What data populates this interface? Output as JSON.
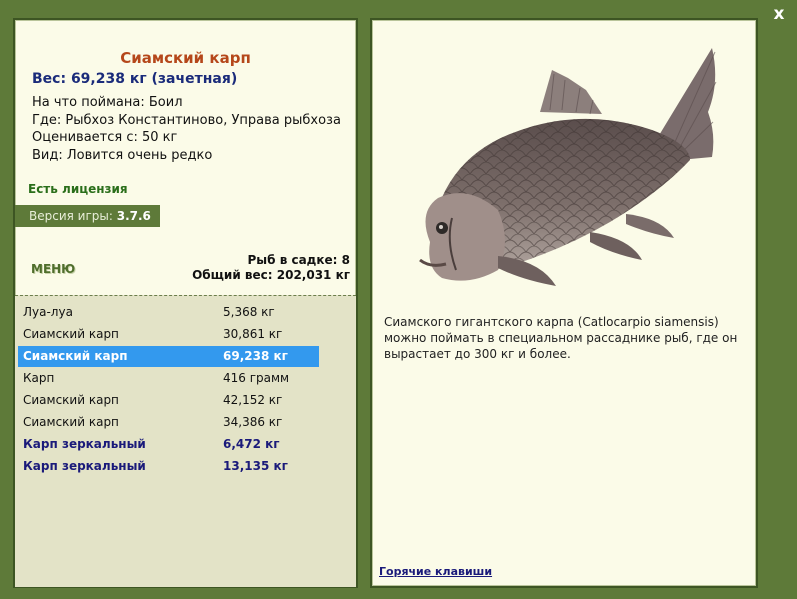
{
  "window": {
    "close_label": "x"
  },
  "fish": {
    "title": "Сиамский карп",
    "weight_line": "Вес: 69,238 кг (зачетная)",
    "details": [
      "На что поймана: Боил",
      "Где: Рыбхоз Константиново, Управа рыбхоза",
      "Оценивается с: 50 кг",
      "Вид: Ловится очень редко"
    ]
  },
  "license_text": "Есть лицензия",
  "version": {
    "label": "Версия игры:",
    "value": "3.7.6"
  },
  "menu_label": "МЕНЮ",
  "cage": {
    "count_line": "Рыб в садке: 8",
    "total_line": "Общий вес: 202,031 кг"
  },
  "catch_list": [
    {
      "name": "Луа-луа",
      "weight": "5,368 кг",
      "style": "normal"
    },
    {
      "name": "Сиамский карп",
      "weight": "30,861 кг",
      "style": "normal"
    },
    {
      "name": "Сиамский карп",
      "weight": "69,238 кг",
      "style": "selected"
    },
    {
      "name": "Карп",
      "weight": "416 грамм",
      "style": "normal"
    },
    {
      "name": "Сиамский карп",
      "weight": "42,152 кг",
      "style": "normal"
    },
    {
      "name": "Сиамский карп",
      "weight": "34,386 кг",
      "style": "normal"
    },
    {
      "name": "Карп зеркальный",
      "weight": "6,472 кг",
      "style": "mirror"
    },
    {
      "name": "Карп зеркальный",
      "weight": "13,135 кг",
      "style": "mirror"
    }
  ],
  "description": "Сиамского гигантского карпа (Catlocarpio siamensis) можно поймать в специальном рассаднике рыб, где он вырастает до 300 кг и более.",
  "hotkeys_label": "Горячие клавиши",
  "colors": {
    "background": "#5e7a39",
    "panel": "#fbfbe8",
    "list_background": "#e3e3c7",
    "selection": "#3399ee",
    "title": "#b5471a",
    "license": "#2a6e1a",
    "mirror_carp": "#1a1a7a"
  }
}
